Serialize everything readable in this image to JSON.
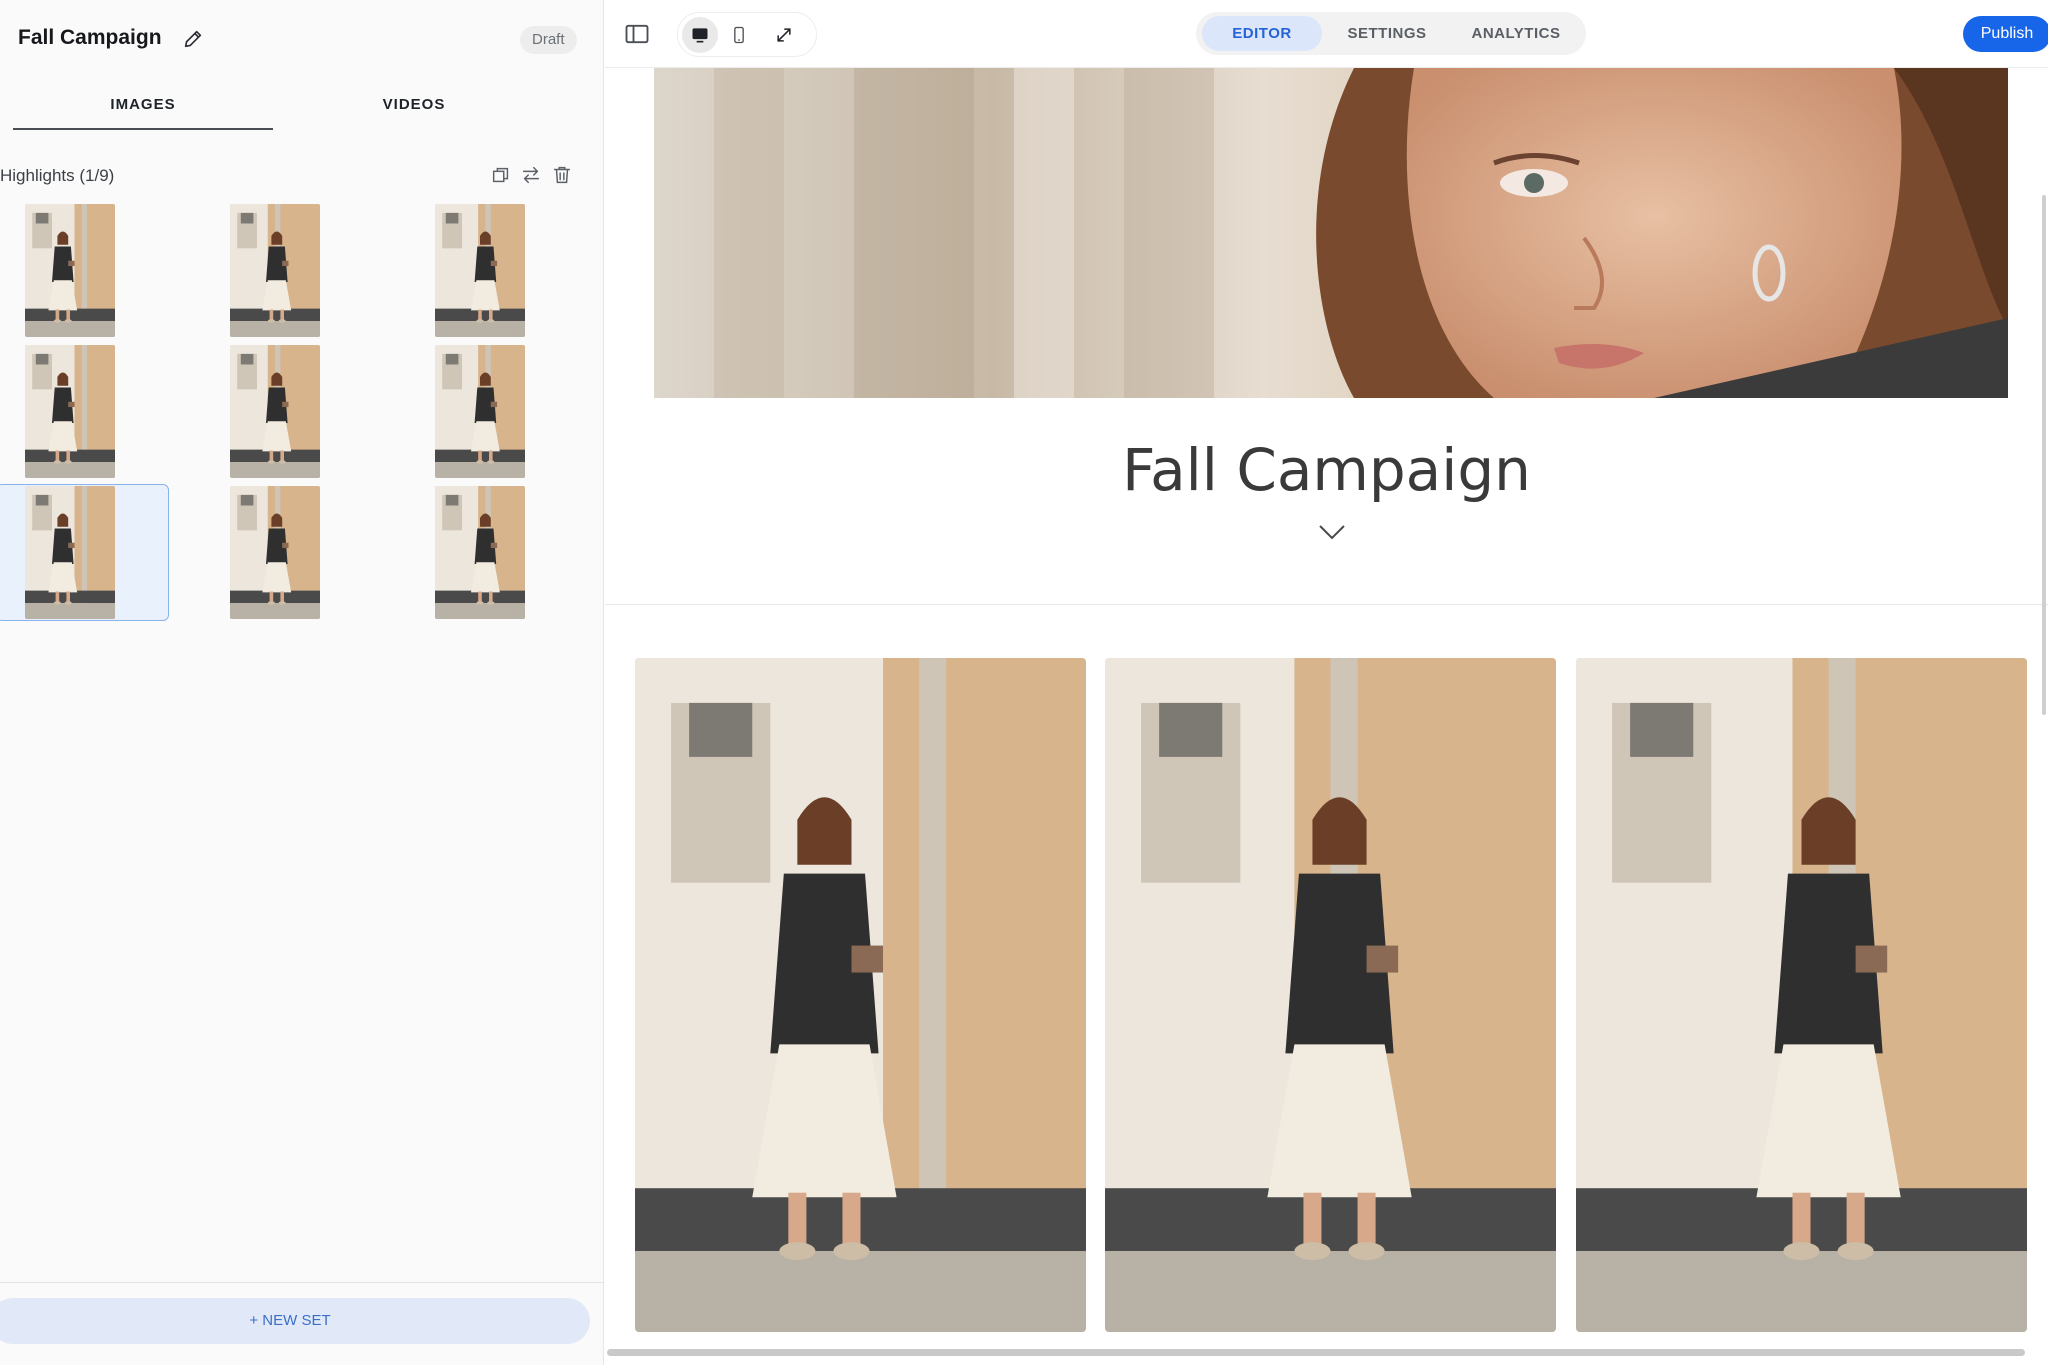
{
  "sidebar": {
    "title": "Fall Campaign",
    "status_badge": "Draft",
    "tabs": [
      {
        "label": "IMAGES",
        "active": true
      },
      {
        "label": "VIDEOS",
        "active": false
      }
    ],
    "set": {
      "label": "Highlights (1/9)",
      "actions": [
        "duplicate-icon",
        "swap-icon",
        "trash-icon"
      ],
      "selected_index": 6,
      "thumbnail_count": 9
    },
    "new_set_label": "+ NEW SET"
  },
  "topbar": {
    "left_icons": [
      "sidebar-toggle-icon",
      "desktop-icon",
      "mobile-icon",
      "expand-icon"
    ],
    "tabs": [
      {
        "label": "EDITOR",
        "active": true
      },
      {
        "label": "SETTINGS",
        "active": false
      },
      {
        "label": "ANALYTICS",
        "active": false
      }
    ],
    "publish_label": "Publish"
  },
  "page": {
    "heading": "Fall Campaign",
    "gallery_count": 3
  },
  "colors": {
    "accent": "#1765e8",
    "tab_active_bg": "#dbe6fb",
    "selection_border": "#8ab3ea"
  }
}
